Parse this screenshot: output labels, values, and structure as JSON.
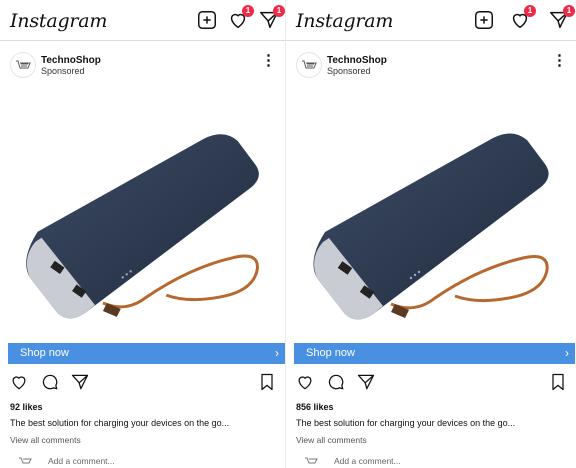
{
  "app": {
    "logo": "Instagram",
    "notification_badge": "1",
    "message_badge": "1"
  },
  "colors": {
    "shop_bar": "#4a90e2",
    "badge": "#ed2b48"
  },
  "posts": [
    {
      "account": "TechnoShop",
      "label": "Sponsored",
      "more_icon": "⋮",
      "shop_button": "Shop now",
      "shop_arrow": "›",
      "likes": "92 likes",
      "caption": "The best solution for charging your devices on the go...",
      "view_comments": "View all comments",
      "add_comment_placeholder": "Add a comment..."
    },
    {
      "account": "TechnoShop",
      "label": "Sponsored",
      "more_icon": "⋮",
      "shop_button": "Shop now",
      "shop_arrow": "›",
      "likes": "856 likes",
      "caption": "The best solution for charging your devices on the go...",
      "view_comments": "View all comments",
      "add_comment_placeholder": "Add a comment..."
    }
  ]
}
